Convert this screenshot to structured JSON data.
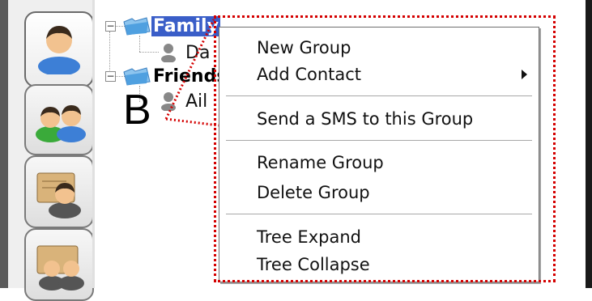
{
  "tree": {
    "groups": [
      {
        "label": "Family",
        "expander": "−",
        "selected": true,
        "contacts": [
          "Da"
        ]
      },
      {
        "label": "Friends",
        "expander": "−",
        "selected": false,
        "contacts": [
          "Ail"
        ]
      }
    ]
  },
  "context_menu": {
    "items": [
      {
        "label": "New Group"
      },
      {
        "label": "Add Contact",
        "has_submenu": true
      },
      {
        "label": "Send a SMS to this Group"
      },
      {
        "label": "Rename Group"
      },
      {
        "label": "Delete Group"
      },
      {
        "label": "Tree Expand"
      },
      {
        "label": "Tree Collapse"
      }
    ]
  },
  "annotation": {
    "letter": "B",
    "color": "#d40000"
  },
  "colors": {
    "selection": "#3a5ec8",
    "folder": "#4fa0e0",
    "contact_icon": "#888888"
  }
}
